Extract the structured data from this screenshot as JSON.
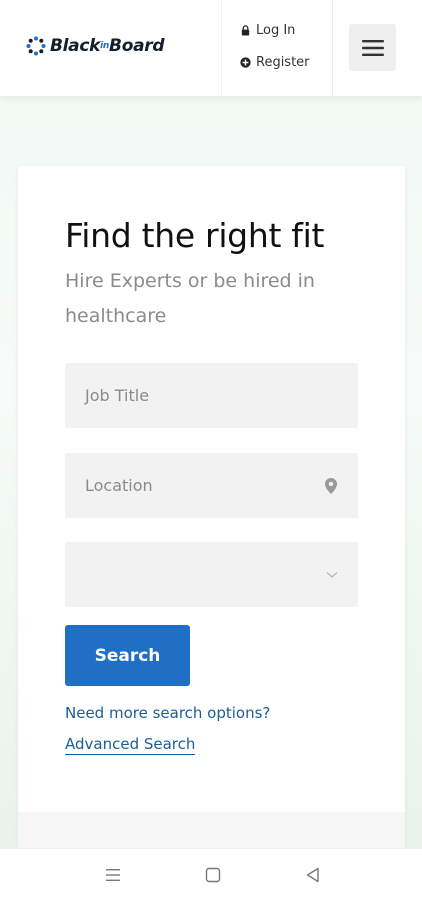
{
  "header": {
    "brand": {
      "left": "Black",
      "mid": "in",
      "right": "Board",
      "icon": "gear-burst-logo-icon"
    },
    "login_label": "Log In",
    "login_icon": "lock-icon",
    "register_label": "Register",
    "register_icon": "plus-circle-icon",
    "menu_icon": "hamburger-menu-icon"
  },
  "search_card": {
    "title": "Find the right fit",
    "subtitle": "Hire Experts or be hired in healthcare",
    "job_title": {
      "placeholder": "Job Title",
      "value": ""
    },
    "location": {
      "placeholder": "Location",
      "value": "",
      "icon": "map-pin-icon"
    },
    "category": {
      "selected": "",
      "icon": "chevron-down-icon"
    },
    "search_button": "Search",
    "more_options_text": "Need more search options?",
    "advanced_link": "Advanced Search"
  },
  "system_nav": {
    "icons": [
      "recents-menu-icon",
      "home-square-icon",
      "back-triangle-icon"
    ]
  },
  "colors": {
    "primary": "#1f6fc5",
    "link": "#1b5d97",
    "background_tint": "#eef7f1",
    "field_bg": "#f2f2f2"
  }
}
